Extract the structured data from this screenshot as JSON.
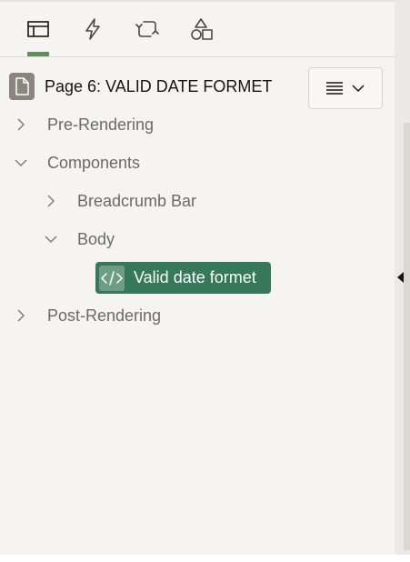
{
  "tabs": [
    {
      "icon": "rendering-tree-icon",
      "active": true
    },
    {
      "icon": "dynamic-actions-icon",
      "active": false
    },
    {
      "icon": "processing-icon",
      "active": false
    },
    {
      "icon": "shared-components-icon",
      "active": false
    }
  ],
  "page": {
    "title": "Page 6: VALID DATE FORMET",
    "icon": "page-icon"
  },
  "menu": {
    "icon": "menu-lines-icon",
    "caret_icon": "chevron-down-icon"
  },
  "tree": {
    "pre_rendering": "Pre-Rendering",
    "components": "Components",
    "breadcrumb_bar": "Breadcrumb Bar",
    "body": "Body",
    "selected_region": "Valid date formet",
    "post_rendering": "Post-Rendering"
  },
  "colors": {
    "accent": "#5f8d57",
    "selected_bg": "#35795a",
    "selected_icon_bg": "#6e9c84",
    "background": "#f5f4f2",
    "tree_text": "#6c6a66"
  }
}
